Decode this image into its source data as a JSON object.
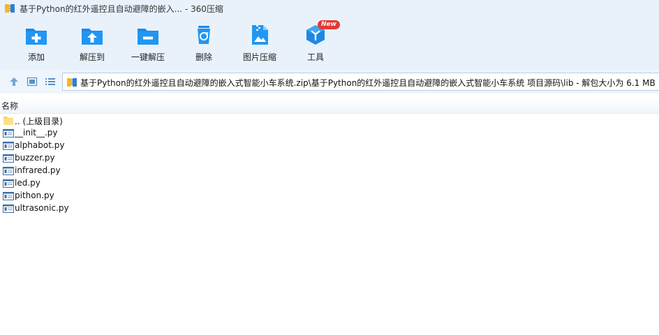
{
  "window": {
    "title": "基于Python的红外遥控且自动避障的嵌入... - 360压缩"
  },
  "toolbar": {
    "items": [
      {
        "label": "添加",
        "icon": "add-folder-icon"
      },
      {
        "label": "解压到",
        "icon": "extract-to-icon"
      },
      {
        "label": "一键解压",
        "icon": "one-click-extract-icon"
      },
      {
        "label": "删除",
        "icon": "recycle-bin-icon"
      },
      {
        "label": "图片压缩",
        "icon": "image-compress-icon"
      },
      {
        "label": "工具",
        "icon": "tools-cube-icon",
        "badge": "New"
      }
    ]
  },
  "address": {
    "path": "基于Python的红外遥控且自动避障的嵌入式智能小车系统.zip\\基于Python的红外遥控且自动避障的嵌入式智能小车系统 项目源码\\lib - 解包大小为 6.1 MB"
  },
  "columns": {
    "name": "名称"
  },
  "files": [
    {
      "name": ".. (上级目录)",
      "type": "folder-up"
    },
    {
      "name": "__init__.py",
      "type": "file"
    },
    {
      "name": "alphabot.py",
      "type": "file"
    },
    {
      "name": "buzzer.py",
      "type": "file"
    },
    {
      "name": "infrared.py",
      "type": "file"
    },
    {
      "name": "led.py",
      "type": "file"
    },
    {
      "name": "pithon.py",
      "type": "file"
    },
    {
      "name": "ultrasonic.py",
      "type": "file"
    }
  ],
  "colors": {
    "accent": "#1e88e5",
    "badge": "#e53935",
    "toolbar_bg": "#e9f2fb"
  }
}
